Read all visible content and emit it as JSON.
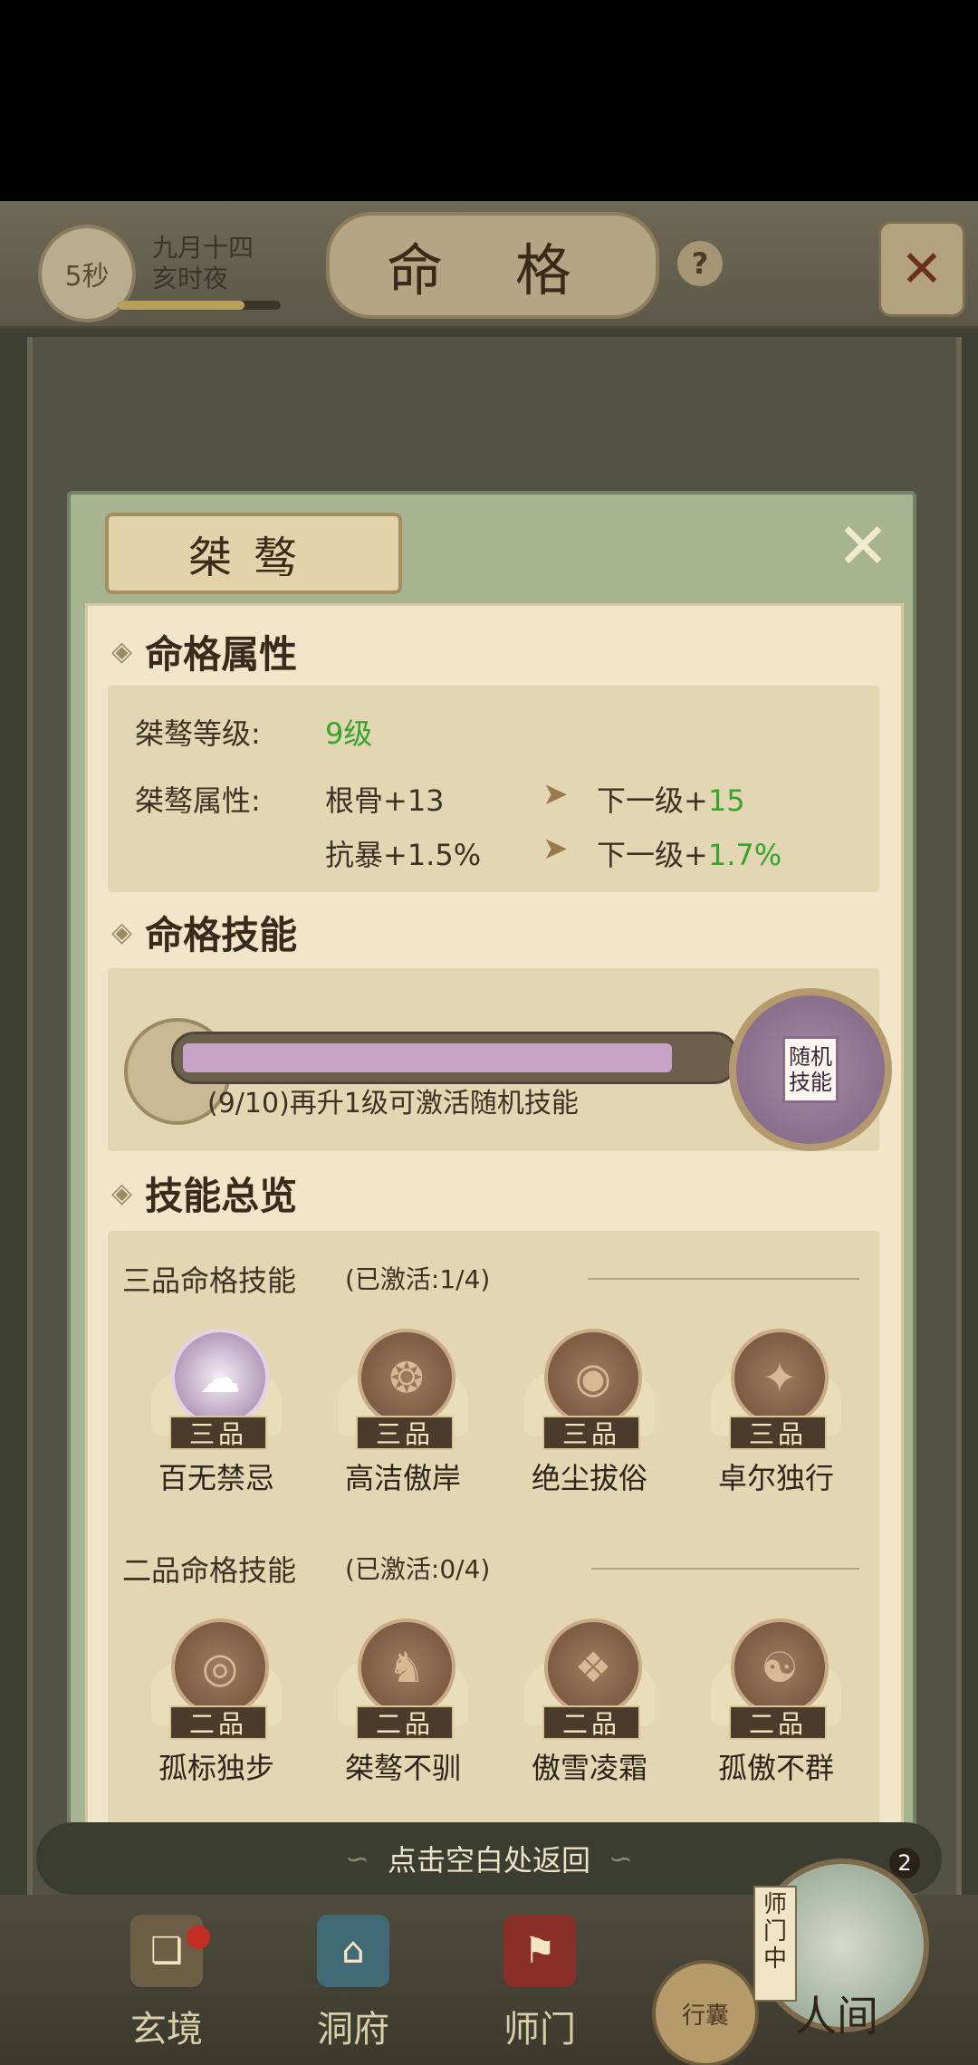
{
  "header": {
    "timer": "5秒",
    "date_line1": "九月十四",
    "date_line2": "亥时夜",
    "title": "命 格",
    "help": "?"
  },
  "dialog": {
    "title": "桀骜",
    "attr_section": "命格属性",
    "level_label": "桀骜等级:",
    "level_value": "9级",
    "attr_label": "桀骜属性:",
    "attrs": [
      {
        "name": "根骨+13",
        "next_prefix": "下一级+",
        "next_value": "15"
      },
      {
        "name": "抗暴+1.5%",
        "next_prefix": "下一级+",
        "next_value": "1.7%"
      }
    ],
    "skill_section": "命格技能",
    "progress_fraction": 0.9,
    "progress_text": "(9/10)再升1级可激活随机技能",
    "random_skill_label": "随机技能",
    "overview_section": "技能总览",
    "grade3": {
      "title": "三品命格技能",
      "status": "(已激活:1/4)",
      "tag": "三品",
      "skills": [
        "百无禁忌",
        "高洁傲岸",
        "绝尘拔俗",
        "卓尔独行"
      ]
    },
    "grade2": {
      "title": "二品命格技能",
      "status": "(已激活:0/4)",
      "tag": "二品",
      "skills": [
        "孤标独步",
        "桀骜不驯",
        "傲雪凌霜",
        "孤傲不群"
      ]
    }
  },
  "footer": {
    "return_hint": "点击空白处返回",
    "nav": [
      "玄境",
      "洞府",
      "师门",
      "行囊",
      "人间"
    ],
    "sect_tag": "师门中",
    "world_badge": "2"
  },
  "colors": {
    "green": "#35a52c",
    "progress": "#c7a3c7",
    "paper": "#f1e6c9"
  }
}
